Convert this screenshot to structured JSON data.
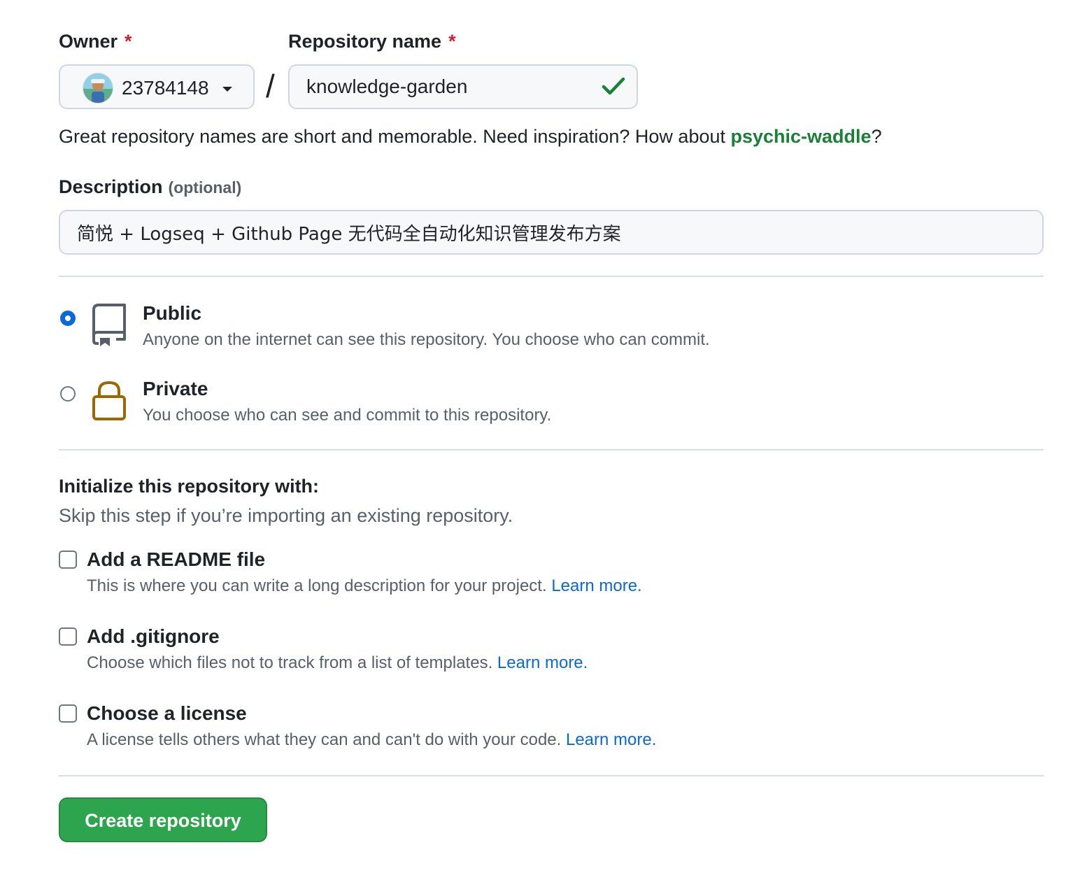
{
  "owner": {
    "label": "Owner",
    "required_mark": "*",
    "value": "23784148"
  },
  "separator": "/",
  "repo_name": {
    "label": "Repository name",
    "required_mark": "*",
    "value": "knowledge-garden"
  },
  "name_hint": {
    "text": "Great repository names are short and memorable. Need inspiration? How about ",
    "suggestion": "psychic-waddle",
    "suffix": "?"
  },
  "description": {
    "label": "Description",
    "optional": "(optional)",
    "value": "简悦 + Logseq + Github Page 无代码全自动化知识管理发布方案"
  },
  "visibility": {
    "selected": "public",
    "options": [
      {
        "key": "public",
        "title": "Public",
        "desc": "Anyone on the internet can see this repository. You choose who can commit."
      },
      {
        "key": "private",
        "title": "Private",
        "desc": "You choose who can see and commit to this repository."
      }
    ]
  },
  "initialize": {
    "heading": "Initialize this repository with:",
    "subheading": "Skip this step if you’re importing an existing repository.",
    "learn_more": "Learn more.",
    "options": [
      {
        "title": "Add a README file",
        "desc": "This is where you can write a long description for your project.",
        "checked": false
      },
      {
        "title": "Add .gitignore",
        "desc": "Choose which files not to track from a list of templates.",
        "checked": false
      },
      {
        "title": "Choose a license",
        "desc": "A license tells others what they can and can't do with your code.",
        "checked": false
      }
    ]
  },
  "submit_label": "Create repository",
  "colors": {
    "accent_blue": "#0969da",
    "success_green": "#2da44e",
    "required_red": "#cf222e",
    "lock_gold": "#9a6700"
  }
}
